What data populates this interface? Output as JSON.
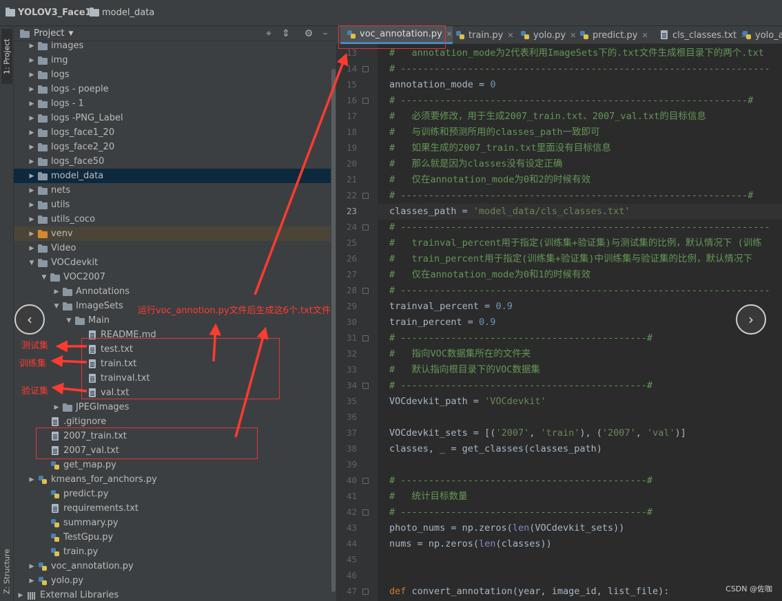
{
  "breadcrumb": {
    "project": "YOLOV3_Face1",
    "folder": "model_data"
  },
  "side_tabs": {
    "project": "1: Project",
    "structure": "Z: Structure"
  },
  "panel": {
    "title": "Project"
  },
  "tree": [
    {
      "label": "images",
      "type": "folder",
      "depth": 0
    },
    {
      "label": "img",
      "type": "folder",
      "depth": 0
    },
    {
      "label": "logs",
      "type": "folder",
      "depth": 0
    },
    {
      "label": "logs - poeple",
      "type": "folder",
      "depth": 0
    },
    {
      "label": "logs - 1",
      "type": "folder",
      "depth": 0
    },
    {
      "label": "logs -PNG_Label",
      "type": "folder",
      "depth": 0
    },
    {
      "label": "logs_face1_20",
      "type": "folder",
      "depth": 0
    },
    {
      "label": "logs_face2_20",
      "type": "folder",
      "depth": 0
    },
    {
      "label": "logs_face50",
      "type": "folder",
      "depth": 0
    },
    {
      "label": "model_data",
      "type": "folder",
      "depth": 0,
      "selected": true
    },
    {
      "label": "nets",
      "type": "folder",
      "depth": 0
    },
    {
      "label": "utils",
      "type": "folder",
      "depth": 0
    },
    {
      "label": "utils_coco",
      "type": "folder",
      "depth": 0
    },
    {
      "label": "venv",
      "type": "folder-orange",
      "depth": 0,
      "venv": true
    },
    {
      "label": "Video",
      "type": "folder",
      "depth": 0
    },
    {
      "label": "VOCdevkit",
      "type": "folder",
      "depth": 0,
      "open": true
    },
    {
      "label": "VOC2007",
      "type": "folder",
      "depth": 1,
      "open": true
    },
    {
      "label": "Annotations",
      "type": "folder",
      "depth": 2
    },
    {
      "label": "ImageSets",
      "type": "folder",
      "depth": 2,
      "open": true
    },
    {
      "label": "Main",
      "type": "folder",
      "depth": 3,
      "open": true
    },
    {
      "label": "README.md",
      "type": "file",
      "depth": 4
    },
    {
      "label": "test.txt",
      "type": "file",
      "depth": 4
    },
    {
      "label": "train.txt",
      "type": "file",
      "depth": 4
    },
    {
      "label": "trainval.txt",
      "type": "file",
      "depth": 4
    },
    {
      "label": "val.txt",
      "type": "file",
      "depth": 4
    },
    {
      "label": "JPEGImages",
      "type": "folder",
      "depth": 2
    },
    {
      "label": ".gitignore",
      "type": "file",
      "depth": 1
    },
    {
      "label": "2007_train.txt",
      "type": "file",
      "depth": 1
    },
    {
      "label": "2007_val.txt",
      "type": "file",
      "depth": 1
    },
    {
      "label": "get_map.py",
      "type": "py",
      "depth": 1
    },
    {
      "label": "kmeans_for_anchors.py",
      "type": "py",
      "depth": 0
    },
    {
      "label": "predict.py",
      "type": "py",
      "depth": 1
    },
    {
      "label": "requirements.txt",
      "type": "file",
      "depth": 1
    },
    {
      "label": "summary.py",
      "type": "py",
      "depth": 1
    },
    {
      "label": "TestGpu.py",
      "type": "py",
      "depth": 1
    },
    {
      "label": "train.py",
      "type": "py",
      "depth": 1
    },
    {
      "label": "voc_annotation.py",
      "type": "py",
      "depth": 0
    },
    {
      "label": "yolo.py",
      "type": "py",
      "depth": 0
    },
    {
      "label": "External Libraries",
      "type": "lib",
      "depth": -1
    }
  ],
  "tabs": [
    {
      "label": "voc_annotation.py",
      "active": true
    },
    {
      "label": "train.py"
    },
    {
      "label": "yolo.py"
    },
    {
      "label": "predict.py"
    },
    {
      "label": "cls_classes.txt"
    },
    {
      "label": "yolo_an"
    }
  ],
  "code": [
    {
      "n": 13,
      "t": [
        [
          "cm",
          "#   annotation_mode为2代表利用ImageSets下的.txt文件生成根目录下的两个.txt"
        ]
      ]
    },
    {
      "n": 14,
      "t": [
        [
          "cm",
          "# ------------------------------------------------------------------"
        ]
      ]
    },
    {
      "n": 15,
      "t": [
        [
          "df",
          "annotation_mode = "
        ],
        [
          "nm",
          "0"
        ]
      ]
    },
    {
      "n": 16,
      "t": [
        [
          "cm",
          "# --------------------------------------------------------------#"
        ]
      ]
    },
    {
      "n": 17,
      "t": [
        [
          "cm",
          "#   必须要修改，用于生成2007_train.txt、2007_val.txt的目标信息"
        ]
      ]
    },
    {
      "n": 18,
      "t": [
        [
          "cm",
          "#   与训练和预测所用的classes_path一致即可"
        ]
      ]
    },
    {
      "n": 19,
      "t": [
        [
          "cm",
          "#   如果生成的2007_train.txt里面没有目标信息"
        ]
      ]
    },
    {
      "n": 20,
      "t": [
        [
          "cm",
          "#   那么就是因为classes没有设定正确"
        ]
      ]
    },
    {
      "n": 21,
      "t": [
        [
          "cm",
          "#   仅在annotation_mode为0和2的时候有效"
        ]
      ]
    },
    {
      "n": 22,
      "t": [
        [
          "cm",
          "# --------------------------------------------------------------#"
        ]
      ]
    },
    {
      "n": 23,
      "cur": true,
      "t": [
        [
          "df",
          "classes_path = "
        ],
        [
          "st",
          "'model_data/cls_classes.txt'"
        ]
      ]
    },
    {
      "n": 24,
      "t": [
        [
          "cm",
          "# ------------------------------------------------------------------"
        ]
      ]
    },
    {
      "n": 25,
      "t": [
        [
          "cm",
          "#   trainval_percent用于指定(训练集+验证集)与测试集的比例，默认情况下 (训练"
        ]
      ]
    },
    {
      "n": 26,
      "t": [
        [
          "cm",
          "#   train_percent用于指定(训练集+验证集)中训练集与验证集的比例，默认情况下"
        ]
      ]
    },
    {
      "n": 27,
      "t": [
        [
          "cm",
          "#   仅在annotation_mode为0和1的时候有效"
        ]
      ]
    },
    {
      "n": 28,
      "t": [
        [
          "cm",
          "# ------------------------------------------------------------------"
        ]
      ]
    },
    {
      "n": 29,
      "t": [
        [
          "df",
          "trainval_percent = "
        ],
        [
          "nm",
          "0.9"
        ]
      ]
    },
    {
      "n": 30,
      "t": [
        [
          "df",
          "train_percent = "
        ],
        [
          "nm",
          "0.9"
        ]
      ]
    },
    {
      "n": 31,
      "t": [
        [
          "cm",
          "# --------------------------------------------#"
        ]
      ]
    },
    {
      "n": 32,
      "t": [
        [
          "cm",
          "#   指向VOC数据集所在的文件夹"
        ]
      ]
    },
    {
      "n": 33,
      "t": [
        [
          "cm",
          "#   默认指向根目录下的VOC数据集"
        ]
      ]
    },
    {
      "n": 34,
      "t": [
        [
          "cm",
          "# --------------------------------------------#"
        ]
      ]
    },
    {
      "n": 35,
      "t": [
        [
          "df",
          "VOCdevkit_path = "
        ],
        [
          "st",
          "'VOCdevkit'"
        ]
      ]
    },
    {
      "n": 36,
      "t": []
    },
    {
      "n": 37,
      "t": [
        [
          "df",
          "VOCdevkit_sets = [("
        ],
        [
          "st",
          "'2007'"
        ],
        [
          "df",
          ", "
        ],
        [
          "st",
          "'train'"
        ],
        [
          "df",
          "), ("
        ],
        [
          "st",
          "'2007'"
        ],
        [
          "df",
          ", "
        ],
        [
          "st",
          "'val'"
        ],
        [
          "df",
          ")]"
        ]
      ]
    },
    {
      "n": 38,
      "t": [
        [
          "df",
          "classes, _ = get_classes(classes_path)"
        ]
      ]
    },
    {
      "n": 39,
      "t": []
    },
    {
      "n": 40,
      "t": [
        [
          "cm",
          "# --------------------------------------------#"
        ]
      ]
    },
    {
      "n": 41,
      "t": [
        [
          "cm",
          "#   统计目标数量"
        ]
      ]
    },
    {
      "n": 42,
      "t": [
        [
          "cm",
          "# --------------------------------------------#"
        ]
      ]
    },
    {
      "n": 43,
      "t": [
        [
          "df",
          "photo_nums = np.zeros("
        ],
        [
          "bi",
          "len"
        ],
        [
          "df",
          "(VOCdevkit_sets))"
        ]
      ]
    },
    {
      "n": 44,
      "t": [
        [
          "df",
          "nums = np.zeros("
        ],
        [
          "bi",
          "len"
        ],
        [
          "df",
          "(classes))"
        ]
      ]
    },
    {
      "n": 45,
      "t": []
    },
    {
      "n": 46,
      "t": []
    },
    {
      "n": 47,
      "t": [
        [
          "kw",
          "def "
        ],
        [
          "df",
          "convert_annotation(year, image_id, list_file):"
        ]
      ]
    }
  ],
  "annotations": {
    "main_note": "运行voc_annotion.py文件后生成这6个.txt文件",
    "test_set": "测试集",
    "train_set": "训练集",
    "val_set": "验证集"
  },
  "watermark": "CSDN @佐咖",
  "colors": {
    "accent": "#4a88c7",
    "annotation_red": "#ff3b30",
    "selection": "#0d293e"
  }
}
